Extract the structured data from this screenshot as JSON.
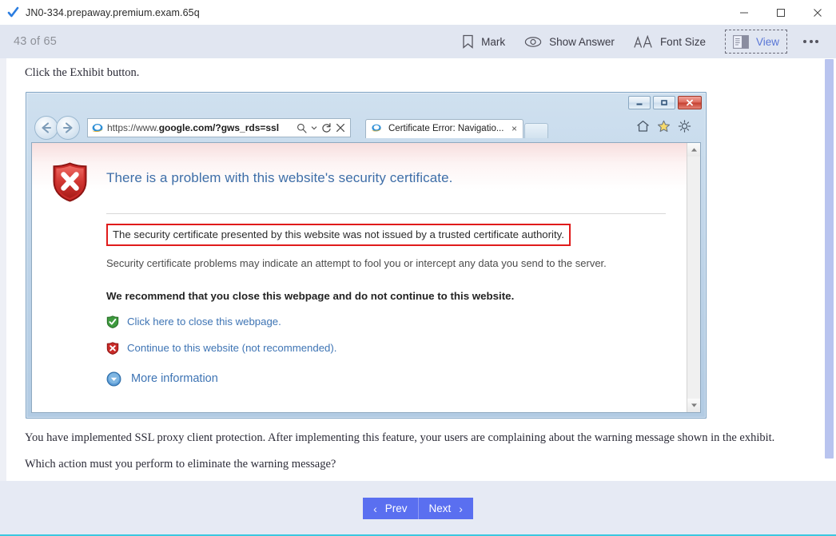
{
  "window": {
    "title": "JN0-334.prepaway.premium.exam.65q",
    "icon": "checkmark-icon",
    "minimize_label": "Minimize",
    "maximize_label": "Maximize",
    "close_label": "Close"
  },
  "toolbar": {
    "counter": "43 of 65",
    "items": [
      {
        "label": "Mark",
        "icon": "bookmark-icon"
      },
      {
        "label": "Show Answer",
        "icon": "eye-icon"
      },
      {
        "label": "Font Size",
        "icon": "font-size-icon"
      },
      {
        "label": "View",
        "icon": "view-layout-icon",
        "focused": true
      },
      {
        "label": "More options",
        "icon": "ellipsis-icon"
      }
    ]
  },
  "question": {
    "prompt": "Click the Exhibit button.",
    "body": "You have implemented SSL proxy client protection. After implementing this feature, your users are complaining about the warning message shown in the exhibit.",
    "ask": "Which action must you perform to eliminate the warning message?"
  },
  "exhibit": {
    "browser": {
      "url_prefix": "https://www.",
      "url_bold": "google.com/?gws_rds=ssl",
      "tab_title": "Certificate Error: Navigatio...",
      "tab_close": "×",
      "back_label": "Back",
      "forward_label": "Forward",
      "search_icon": "search-icon",
      "dropdown_icon": "chevron-down-icon",
      "refresh_icon": "refresh-icon",
      "stop_icon": "close-icon",
      "home_icon": "home-icon",
      "favorites_icon": "star-icon",
      "settings_icon": "gear-icon",
      "new_tab_label": "New tab"
    },
    "error_page": {
      "shield_icon": "red-shield-error-icon",
      "title": "There is a problem with this website's security certificate.",
      "highlighted": "The security certificate presented by this website was not issued by a trusted certificate authority.",
      "paragraph": "Security certificate problems may indicate an attempt to fool you or intercept any data you send to the server.",
      "recommendation": "We recommend that you close this webpage and do not continue to this website.",
      "links": [
        {
          "label": "Click here to close this webpage.",
          "icon": "green-shield-check-icon"
        },
        {
          "label": "Continue to this website (not recommended).",
          "icon": "red-shield-x-icon"
        },
        {
          "label": "More information",
          "icon": "expand-circle-icon"
        }
      ]
    }
  },
  "footer": {
    "prev_label": "Prev",
    "next_label": "Next",
    "prev_chevron": "‹",
    "next_chevron": "›"
  },
  "colors": {
    "accent": "#5a6ff0",
    "toolbar_bg": "#e1e6f1",
    "link_blue": "#3e74b4",
    "alert_red": "#e01b1b",
    "heading_blue": "#3e6ea8"
  }
}
